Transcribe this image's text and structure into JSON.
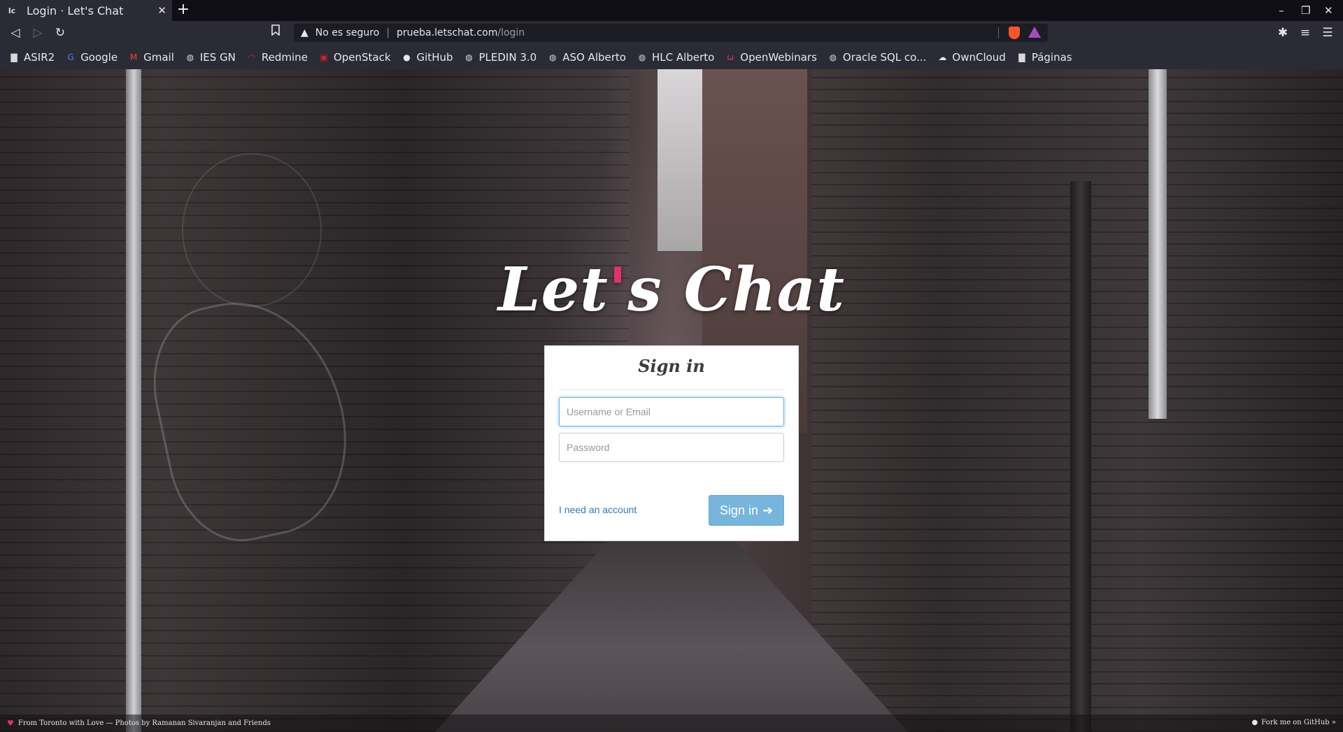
{
  "browser": {
    "tab": {
      "favicon": "lc",
      "title": "Login · Let's Chat",
      "close": "✕"
    },
    "new_tab": "+",
    "window_controls": {
      "minimize": "–",
      "maximize": "❐",
      "close": "✕"
    },
    "nav": {
      "back": "◁",
      "forward": "▷",
      "reload": "↻",
      "bookmark": "🔖"
    },
    "url": {
      "warning_icon": "▲",
      "security_label": "No es seguro",
      "separator": "|",
      "host": "prueba.letschat.com",
      "path": "/login"
    },
    "extensions": {
      "puzzle": "✱",
      "media": "≡",
      "menu": "☰"
    }
  },
  "bookmarks": [
    {
      "label": "ASIR2",
      "icon": "folder-icon",
      "glyph": "▇",
      "color": "#d8d8d8"
    },
    {
      "label": "Google",
      "icon": "google-icon",
      "glyph": "G",
      "color": "#4285f4"
    },
    {
      "label": "Gmail",
      "icon": "gmail-icon",
      "glyph": "M",
      "color": "#ea4335"
    },
    {
      "label": "IES GN",
      "icon": "globe-icon",
      "glyph": "◍",
      "color": "#d8d8d8"
    },
    {
      "label": "Redmine",
      "icon": "redmine-icon",
      "glyph": "◠",
      "color": "#c0392b"
    },
    {
      "label": "OpenStack",
      "icon": "openstack-icon",
      "glyph": "▣",
      "color": "#da1a32"
    },
    {
      "label": "GitHub",
      "icon": "github-icon",
      "glyph": "●",
      "color": "#e8e8e8"
    },
    {
      "label": "PLEDIN 3.0",
      "icon": "globe-icon",
      "glyph": "◍",
      "color": "#d8d8d8"
    },
    {
      "label": "ASO Alberto",
      "icon": "globe-icon",
      "glyph": "◍",
      "color": "#d8d8d8"
    },
    {
      "label": "HLC Alberto",
      "icon": "globe-icon",
      "glyph": "◍",
      "color": "#d8d8d8"
    },
    {
      "label": "OpenWebinars",
      "icon": "openwebinars-icon",
      "glyph": "ω",
      "color": "#e0336b"
    },
    {
      "label": "Oracle SQL co...",
      "icon": "globe-icon",
      "glyph": "◍",
      "color": "#d8d8d8"
    },
    {
      "label": "OwnCloud",
      "icon": "cloud-icon",
      "glyph": "☁",
      "color": "#e8e8e8"
    },
    {
      "label": "Páginas",
      "icon": "folder-icon",
      "glyph": "▇",
      "color": "#d8d8d8"
    }
  ],
  "logo": {
    "part1": "Let",
    "apostrophe": "'",
    "part2": "s Chat"
  },
  "login": {
    "title": "Sign in",
    "username_placeholder": "Username or Email",
    "password_placeholder": "Password",
    "register_link": "I need an account",
    "submit_label": "Sign in",
    "submit_icon": "➔"
  },
  "footer": {
    "credit": "From Toronto with Love — Photos by Ramanan Sivaranjan and Friends",
    "github": "Fork me on GitHub »"
  },
  "colors": {
    "accent": "#e0336b",
    "button": "#76b5dc",
    "link": "#337ab7"
  }
}
